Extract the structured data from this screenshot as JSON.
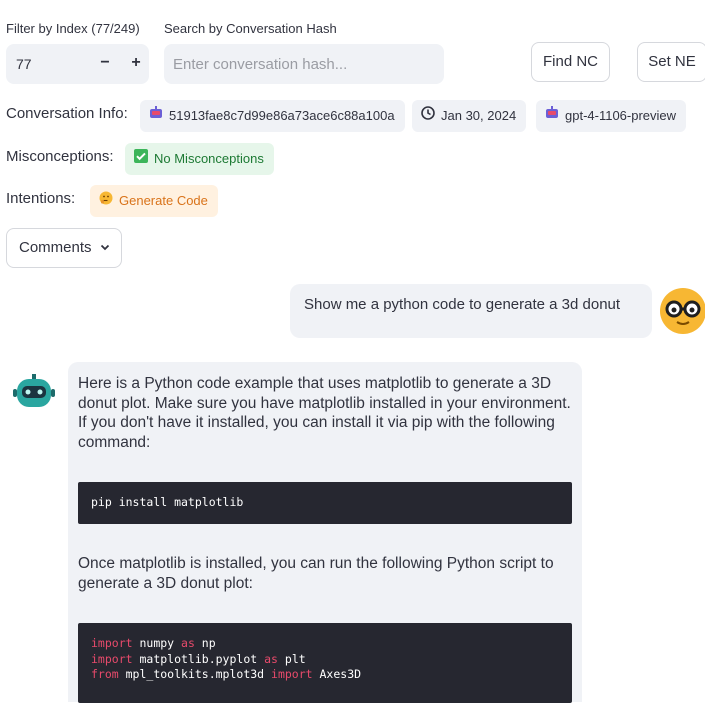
{
  "filter": {
    "label": "Filter by Index (77/249)",
    "value": "77",
    "decrement": "−",
    "increment": "+"
  },
  "search": {
    "label": "Search by Conversation Hash",
    "placeholder": "Enter conversation hash..."
  },
  "buttons": {
    "find": "Find NC",
    "set": "Set NE",
    "comments": "Comments"
  },
  "info": {
    "label": "Conversation Info:",
    "hash": "51913fae8c7d99e86a73ace6c88a100a",
    "date": "Jan 30, 2024",
    "model": "gpt-4-1106-preview"
  },
  "misconceptions": {
    "label": "Misconceptions:",
    "badge": "No Misconceptions"
  },
  "intentions": {
    "label": "Intentions:",
    "badge": "Generate Code"
  },
  "chat": {
    "user_message": "Show me a python code to generate a 3d donut",
    "assistant": {
      "intro": "Here is a Python code example that uses matplotlib to generate a 3D donut plot. Make sure you have matplotlib installed in your environment. If you don't have it installed, you can install it via pip with the following command:",
      "install_cmd": "pip install matplotlib",
      "middle": "Once matplotlib is installed, you can run the following Python script to generate a 3D donut plot:",
      "code": {
        "l1_kw": "import",
        "l1_mod": " numpy ",
        "l1_as": "as",
        "l1_alias": " np",
        "l2_kw": "import",
        "l2_mod": " matplotlib.pyplot ",
        "l2_as": "as",
        "l2_alias": " plt",
        "l3_kw": "from",
        "l3_mod": " mpl_toolkits.mplot3d ",
        "l3_imp": "import",
        "l3_name": " Axes3D"
      }
    }
  },
  "colors": {
    "accent_green": "#1d7a34",
    "accent_orange": "#d9731a",
    "code_bg": "#262730",
    "keyword": "#e74a6b"
  }
}
